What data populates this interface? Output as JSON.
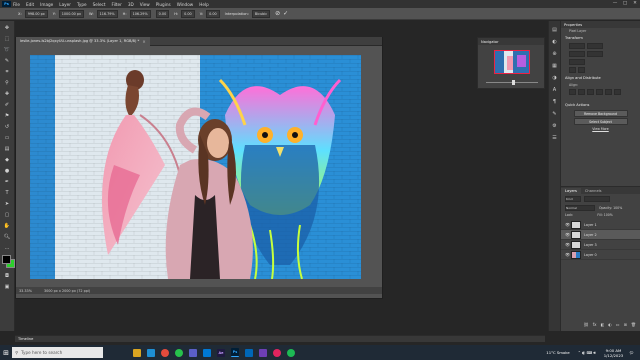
{
  "menubar": {
    "app_logo": "Ps",
    "items": [
      "File",
      "Edit",
      "Image",
      "Layer",
      "Type",
      "Select",
      "Filter",
      "3D",
      "View",
      "Plugins",
      "Window",
      "Help"
    ],
    "window_controls": [
      "—",
      "□",
      "✕"
    ]
  },
  "options_bar": {
    "fields": [
      {
        "label": "X:",
        "value": "998.00 px"
      },
      {
        "label": "Y:",
        "value": "1000.00 px"
      },
      {
        "label": "W:",
        "value": "116.79%"
      },
      {
        "label": "H:",
        "value": "106.29%"
      },
      {
        "label": "",
        "value": "0.00"
      },
      {
        "label": "H:",
        "value": "0.00"
      },
      {
        "label": "V:",
        "value": "0.00"
      },
      {
        "label": "Interpolation:",
        "value": "Bicubic"
      }
    ]
  },
  "document": {
    "tab_title": "leslie-jones-Is2bJ2qxyUU-unsplash.jpg @ 33.3% (Layer 1, RGB/8) *",
    "close_glyph": "×",
    "status_zoom": "33.33%",
    "status_size": "3000 px x 2000 px (72 ppi)"
  },
  "navigator": {
    "title": "Navigator"
  },
  "properties": {
    "title": "Properties",
    "kind": "Pixel Layer",
    "transform_label": "Transform",
    "align_label": "Align and Distribute",
    "align_sub": "Align:",
    "quick_actions_label": "Quick Actions",
    "buttons": [
      "Remove Background",
      "Select Subject"
    ],
    "more_link": "View More"
  },
  "layers": {
    "tabs": [
      "Layers",
      "Channels"
    ],
    "kind_label": "Kind",
    "blend_mode": "Normal",
    "opacity": "Opacity: 100%",
    "lock_label": "Lock:",
    "fill": "Fill: 100%",
    "rows": [
      {
        "name": "Layer 1",
        "selected": false,
        "image": false
      },
      {
        "name": "Layer 2",
        "selected": true,
        "image": false
      },
      {
        "name": "Layer 3",
        "selected": false,
        "image": false
      },
      {
        "name": "Layer 0",
        "selected": false,
        "image": true
      }
    ]
  },
  "timeline": {
    "title": "Timeline"
  },
  "taskbar": {
    "search_placeholder": "Type here to search",
    "apps": [
      "folder-icon",
      "edge-icon",
      "chrome-icon",
      "whatsapp-icon",
      "teams-icon",
      "store-icon",
      "ae-icon",
      "ps-icon",
      "vscode-icon",
      "app-icon",
      "music-icon",
      "spotify-icon"
    ],
    "weather": "11°C  Smoke",
    "time": "9:00 AM",
    "date": "1/12/2023"
  },
  "colors": {
    "accent": "#31a8ff",
    "panel_bg": "#424242",
    "workspace_bg": "#262626",
    "selection_row": "#5a5a5a"
  }
}
